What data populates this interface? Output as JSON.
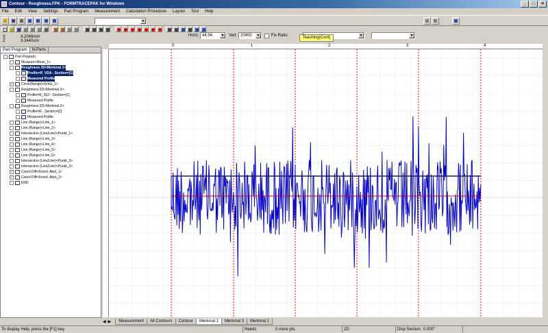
{
  "window": {
    "title": "Contour - Roughness.FPK - FORMTRACEPAK for Windows",
    "controls": [
      "_",
      "□",
      "×"
    ]
  },
  "menu": [
    "File",
    "Edit",
    "View",
    "Settings",
    "Part Program",
    "Measurement",
    "Calculation Procedure",
    "Layout",
    "Tool",
    "Help"
  ],
  "toolbar": {
    "horiz_label": "Horiz.",
    "horiz_value": "44.94",
    "vert_label": "Vert.",
    "vert_value": "20400",
    "fix_ratio_label": "Fix Ratio"
  },
  "teaching": "Teaching(Cont)",
  "coords": {
    "x_label": "X",
    "x_value": "4.2049mm",
    "z_label": "Z",
    "z_value": "3.3440um"
  },
  "left_tabs": [
    "Part Program",
    "N-Parts"
  ],
  "tree": [
    {
      "label": "Part Program",
      "level": 0,
      "checked": false,
      "selected": false
    },
    {
      "label": "Measure<Meas_1>",
      "level": 1,
      "checked": false,
      "selected": false
    },
    {
      "label": "Roughness 2D<Merkmal 1>",
      "level": 1,
      "checked": false,
      "selected": true
    },
    {
      "label": "Profile=R_VDA - Section=[1]",
      "level": 2,
      "checked": false,
      "selected": true
    },
    {
      "label": "Measured Profile",
      "level": 2,
      "checked": false,
      "selected": true
    },
    {
      "label": "Circle(Range)<Kreis_1>",
      "level": 1,
      "checked": true,
      "selected": false
    },
    {
      "label": "Roughness 2D<Merkmal 3>",
      "level": 1,
      "checked": false,
      "selected": false
    },
    {
      "label": "Profile=R_ISO - Section=[1]",
      "level": 2,
      "checked": false,
      "selected": false
    },
    {
      "label": "Measured Profile",
      "level": 2,
      "checked": false,
      "selected": false
    },
    {
      "label": "Roughness 2D<Merkmal 2>",
      "level": 1,
      "checked": false,
      "selected": false
    },
    {
      "label": "Profile=R - Section=[1]",
      "level": 2,
      "checked": false,
      "selected": false
    },
    {
      "label": "Measured Profile",
      "level": 2,
      "checked": false,
      "selected": false
    },
    {
      "label": "Line (Range)<Line_1>",
      "level": 1,
      "checked": false,
      "selected": false
    },
    {
      "label": "Line (Range)<Line_2>",
      "level": 1,
      "checked": false,
      "selected": false
    },
    {
      "label": "Intersection (Line/Line)<Punkt_1>",
      "level": 1,
      "checked": false,
      "selected": false
    },
    {
      "label": "Line (Range)<Line_3>",
      "level": 1,
      "checked": false,
      "selected": false
    },
    {
      "label": "Line (Range)<Line_4>",
      "level": 1,
      "checked": false,
      "selected": false
    },
    {
      "label": "Line (Range)<Line_5>",
      "level": 1,
      "checked": false,
      "selected": false
    },
    {
      "label": "Line (Range)<Line_6>",
      "level": 1,
      "checked": false,
      "selected": false
    },
    {
      "label": "Intersection (Line/Line)<Punkt_2>",
      "level": 1,
      "checked": false,
      "selected": false
    },
    {
      "label": "Intersection (Line/Line)<Punkt_3>",
      "level": 1,
      "checked": false,
      "selected": false
    },
    {
      "label": "Coord Diff<Koord. Abst_1>",
      "level": 1,
      "checked": true,
      "selected": false
    },
    {
      "label": "Coord Diff<Koord. Abst_2>",
      "level": 1,
      "checked": true,
      "selected": false
    },
    {
      "label": "END",
      "level": 1,
      "checked": false,
      "selected": false
    }
  ],
  "ruler_marks": [
    "0",
    "1",
    "2",
    "3",
    "4"
  ],
  "bottom_tabs": [
    "Measurement",
    "All Contours",
    "Contour",
    "Merkmal 1",
    "Merkmal 3",
    "Merkmal 2"
  ],
  "active_tab_index": 3,
  "status": {
    "help": "To display Help, press the [F1] key.",
    "needs": "Needs",
    "points": "0 more pts.",
    "mode": "2D",
    "disp_section": "Disp Section:",
    "disp_value": "0.000\""
  },
  "colors": {
    "profile": "#0000d0",
    "section_line": "#e00000",
    "mean_line": "#1a1a50",
    "ref_line": "#cc0000"
  }
}
